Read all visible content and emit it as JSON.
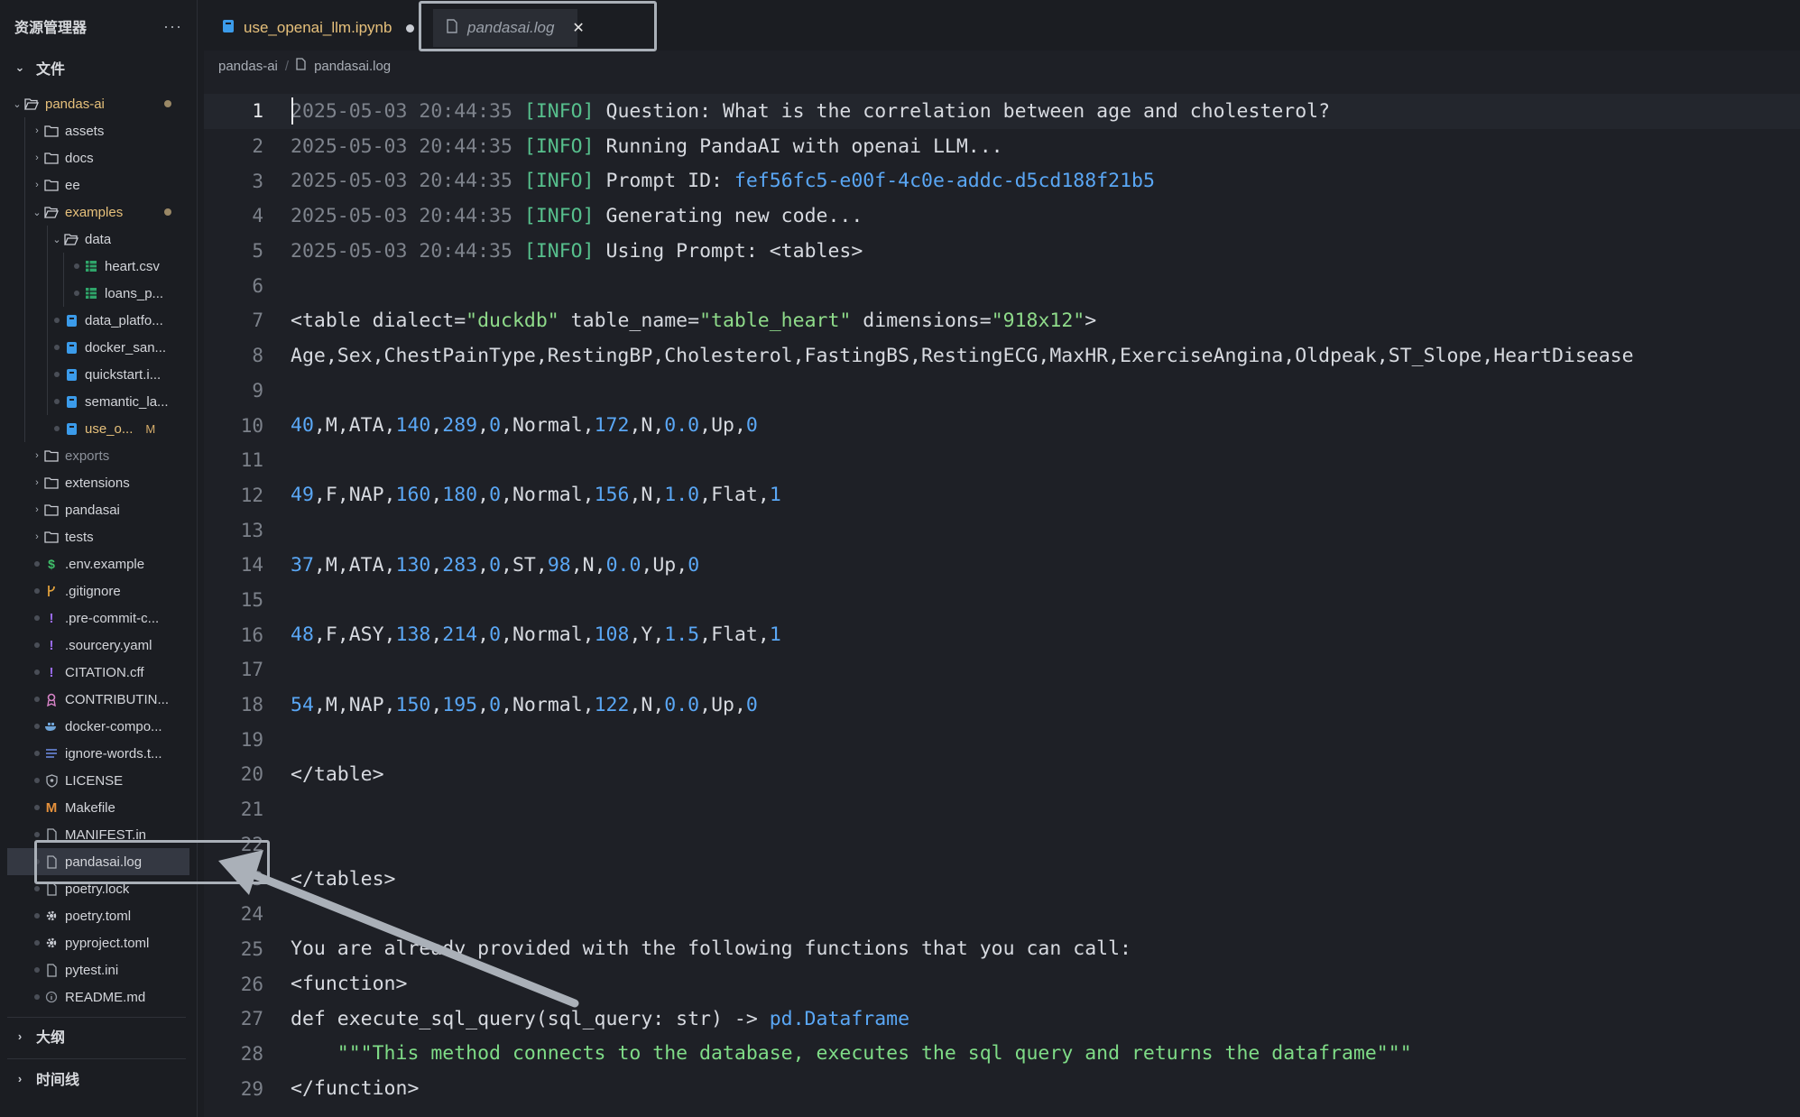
{
  "sidebar": {
    "title": "资源管理器",
    "more": "···",
    "files_section": "文件",
    "outline_section": "大纲",
    "timeline_section": "时间线",
    "items": [
      {
        "label": "pandas-ai",
        "icon": "folder-open-icon",
        "expanded": true,
        "modified": true
      },
      {
        "label": "assets",
        "icon": "folder-icon"
      },
      {
        "label": "docs",
        "icon": "folder-icon"
      },
      {
        "label": "ee",
        "icon": "folder-icon"
      },
      {
        "label": "examples",
        "icon": "folder-open-icon",
        "expanded": true,
        "modified": true
      },
      {
        "label": "data",
        "icon": "folder-open-icon",
        "expanded": true
      },
      {
        "label": "heart.csv",
        "icon": "csv-icon"
      },
      {
        "label": "loans_p...",
        "icon": "csv-icon"
      },
      {
        "label": "data_platfo...",
        "icon": "notebook-icon"
      },
      {
        "label": "docker_san...",
        "icon": "notebook-icon"
      },
      {
        "label": "quickstart.i...",
        "icon": "notebook-icon"
      },
      {
        "label": "semantic_la...",
        "icon": "notebook-icon"
      },
      {
        "label": "use_o...",
        "icon": "notebook-icon",
        "badge": "M"
      },
      {
        "label": "exports",
        "icon": "folder-icon"
      },
      {
        "label": "extensions",
        "icon": "folder-icon"
      },
      {
        "label": "pandasai",
        "icon": "folder-icon"
      },
      {
        "label": "tests",
        "icon": "folder-icon"
      },
      {
        "label": ".env.example",
        "icon": "dollar-icon"
      },
      {
        "label": ".gitignore",
        "icon": "git-icon"
      },
      {
        "label": ".pre-commit-c...",
        "icon": "exclamation-icon"
      },
      {
        "label": ".sourcery.yaml",
        "icon": "exclamation-icon"
      },
      {
        "label": "CITATION.cff",
        "icon": "exclamation-icon"
      },
      {
        "label": "CONTRIBUTIN...",
        "icon": "ribbon-icon"
      },
      {
        "label": "docker-compo...",
        "icon": "docker-icon"
      },
      {
        "label": "ignore-words.t...",
        "icon": "lines-icon"
      },
      {
        "label": "LICENSE",
        "icon": "shield-icon"
      },
      {
        "label": "Makefile",
        "icon": "makefile-icon"
      },
      {
        "label": "MANIFEST.in",
        "icon": "file-icon"
      },
      {
        "label": "pandasai.log",
        "icon": "file-icon",
        "selected": true
      },
      {
        "label": "poetry.lock",
        "icon": "file-icon"
      },
      {
        "label": "poetry.toml",
        "icon": "gear-icon"
      },
      {
        "label": "pyproject.toml",
        "icon": "gear-icon"
      },
      {
        "label": "pytest.ini",
        "icon": "file-icon"
      },
      {
        "label": "README.md",
        "icon": "info-icon"
      }
    ]
  },
  "tabs": [
    {
      "label": "use_openai_llm.ipynb",
      "icon": "notebook-icon",
      "dirty": true
    },
    {
      "label": "pandasai.log",
      "icon": "file-icon",
      "active": true,
      "close": "✕"
    }
  ],
  "breadcrumb": [
    "pandas-ai",
    "/",
    "pandasai.log"
  ],
  "code_lines": [
    "2025-05-03 20:44:35 [INFO] Question: What is the correlation between age and cholesterol?",
    "2025-05-03 20:44:35 [INFO] Running PandaAI with openai LLM...",
    "2025-05-03 20:44:35 [INFO] Prompt ID: fef56fc5-e00f-4c0e-addc-d5cd188f21b5",
    "2025-05-03 20:44:35 [INFO] Generating new code...",
    "2025-05-03 20:44:35 [INFO] Using Prompt: <tables>",
    "",
    "<table dialect=\"duckdb\" table_name=\"table_heart\" dimensions=\"918x12\">",
    "Age,Sex,ChestPainType,RestingBP,Cholesterol,FastingBS,RestingECG,MaxHR,ExerciseAngina,Oldpeak,ST_Slope,HeartDisease",
    "",
    "40,M,ATA,140,289,0,Normal,172,N,0.0,Up,0",
    "",
    "49,F,NAP,160,180,0,Normal,156,N,1.0,Flat,1",
    "",
    "37,M,ATA,130,283,0,ST,98,N,0.0,Up,0",
    "",
    "48,F,ASY,138,214,0,Normal,108,Y,1.5,Flat,1",
    "",
    "54,M,NAP,150,195,0,Normal,122,N,0.0,Up,0",
    "",
    "</table>",
    "",
    "",
    "</tables>",
    "",
    "You are already provided with the following functions that you can call:",
    "<function>",
    "def execute_sql_query(sql_query: str) -> pd.Dataframe",
    "    \"\"\"This method connects to the database, executes the sql query and returns the dataframe\"\"\"",
    "</function>"
  ],
  "cursor_line": 1,
  "colors": {
    "timestamp": "#7e838c",
    "level": "#57c08d",
    "number": "#5aa7f5",
    "string": "#8fdb8a",
    "annotation": "#aab0b8"
  }
}
